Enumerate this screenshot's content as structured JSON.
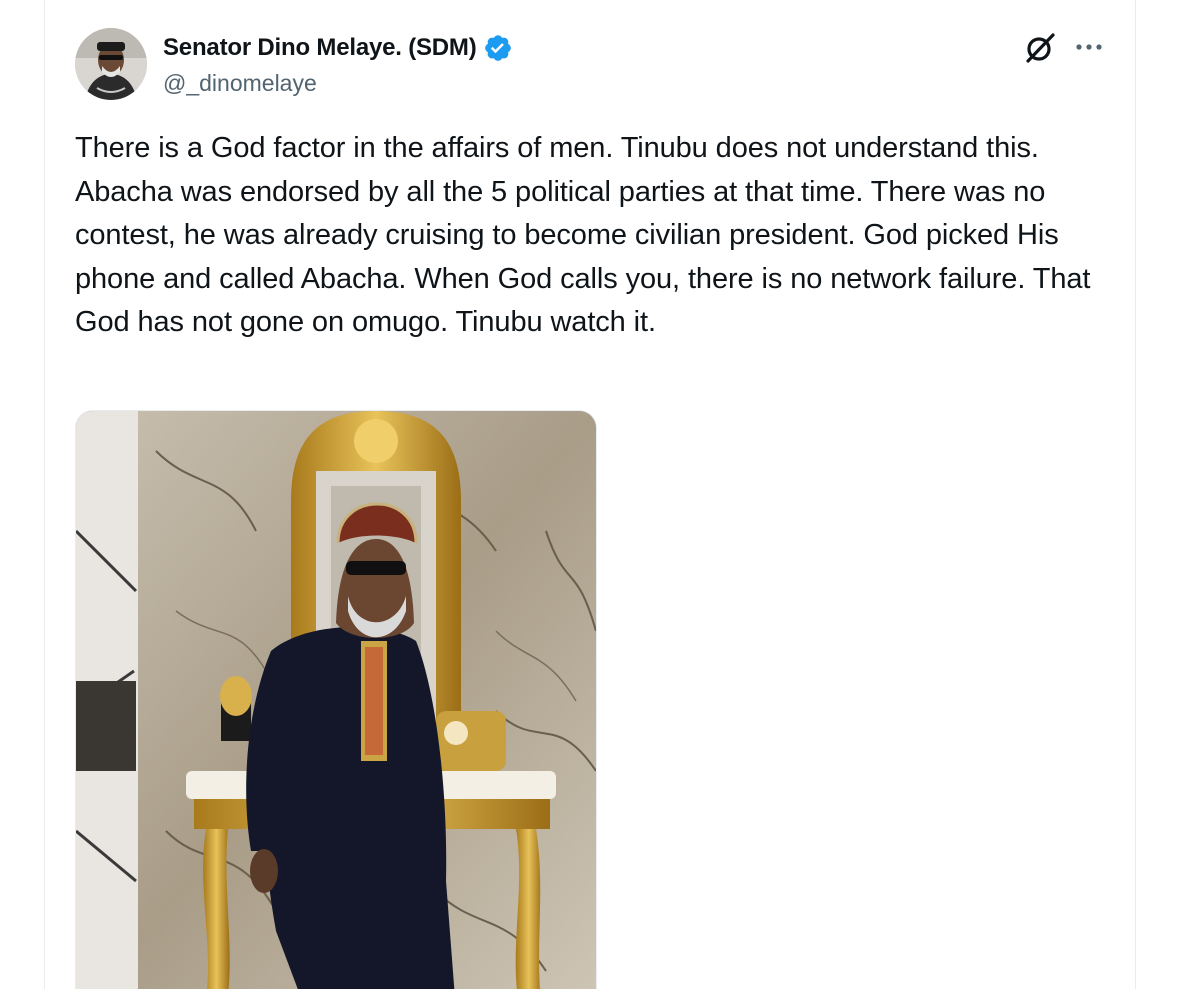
{
  "tweet": {
    "author": {
      "display_name": "Senator Dino Melaye. (SDM)",
      "handle": "@_dinomelaye",
      "verified": true,
      "avatar_icon": "profile-photo"
    },
    "text": "There is a God factor in the affairs of men. Tinubu does not understand this. Abacha was endorsed by all the 5 political parties at that time. There was no contest, he was already cruising to become civilian president. God picked His phone and called Abacha. When God calls you, there is no network failure. That God has not gone on omugo. Tinubu watch it.",
    "media": {
      "type": "photo"
    },
    "actions": {
      "grok_icon": "grok-icon",
      "more_icon": "more-options-icon"
    }
  },
  "colors": {
    "text_primary": "#0f1419",
    "text_secondary": "#536471",
    "verified_blue": "#1d9bf0",
    "border": "#e6ecf0"
  }
}
